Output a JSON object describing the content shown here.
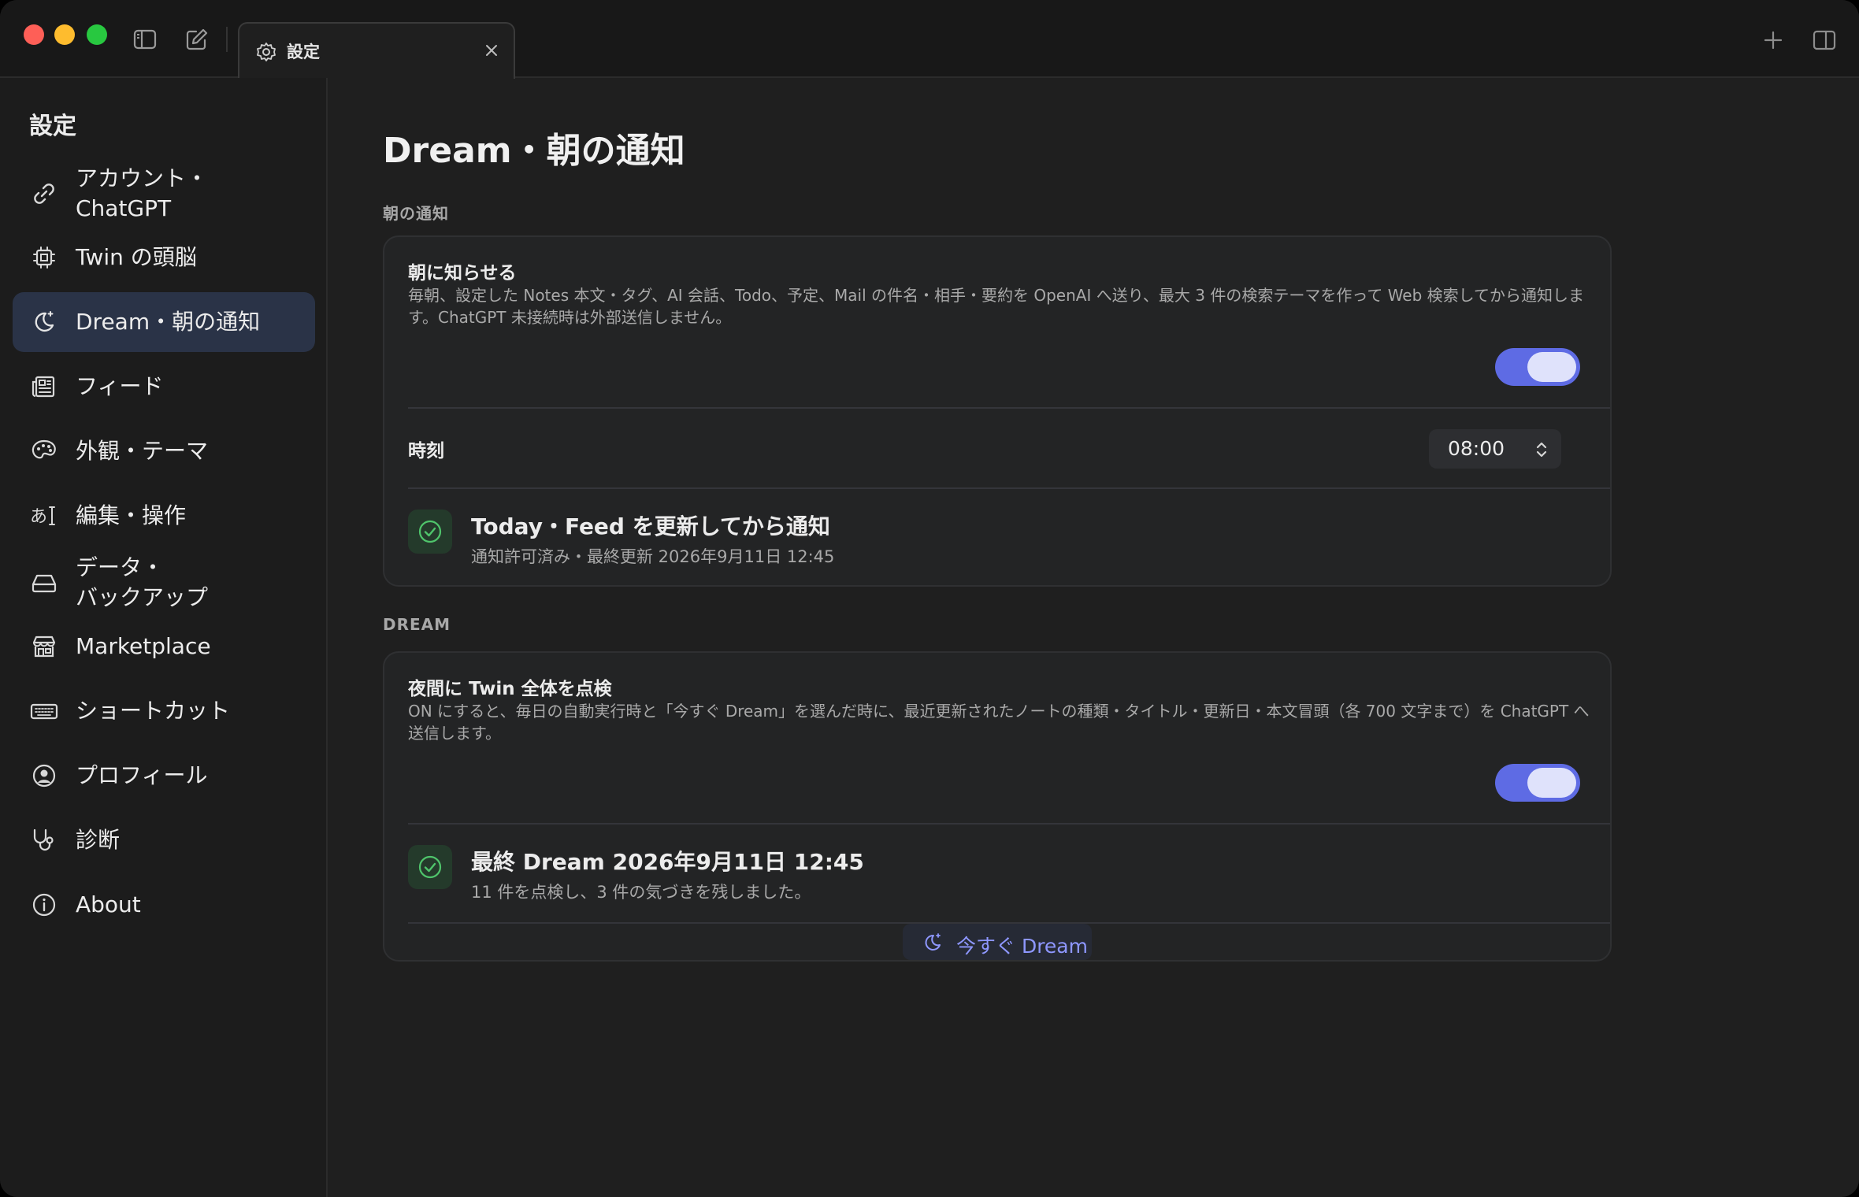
{
  "tab": {
    "label": "設定"
  },
  "sidebar": {
    "title": "設定",
    "items": [
      {
        "label": "アカウント・\nChatGPT",
        "icon": "link-icon"
      },
      {
        "label": "Twin の頭脳",
        "icon": "chip-icon"
      },
      {
        "label": "Dream・朝の通知",
        "icon": "moon-icon",
        "active": true
      },
      {
        "label": "フィード",
        "icon": "newspaper-icon"
      },
      {
        "label": "外観・テーマ",
        "icon": "palette-icon"
      },
      {
        "label": "編集・操作",
        "icon": "text-cursor-icon"
      },
      {
        "label": "データ・\nバックアップ",
        "icon": "drive-icon"
      },
      {
        "label": "Marketplace",
        "icon": "store-icon"
      },
      {
        "label": "ショートカット",
        "icon": "keyboard-icon"
      },
      {
        "label": "プロフィール",
        "icon": "user-circle-icon"
      },
      {
        "label": "診断",
        "icon": "stethoscope-icon"
      },
      {
        "label": "About",
        "icon": "info-icon"
      }
    ]
  },
  "main": {
    "title": "Dream・朝の通知",
    "morning": {
      "section_label": "朝の通知",
      "notify_title": "朝に知らせる",
      "notify_desc": "毎朝、設定した Notes 本文・タグ、AI 会話、Todo、予定、Mail の件名・相手・要約を OpenAI へ送り、最大 3 件の検索テーマを作って Web 検索してから通知します。ChatGPT 未接続時は外部送信しません。",
      "notify_enabled": true,
      "time_label": "時刻",
      "time_value": "08:00",
      "status_title": "Today・Feed を更新してから通知",
      "status_sub": "通知許可済み・最終更新 2026年9月11日 12:45"
    },
    "dream": {
      "section_label": "DREAM",
      "check_title": "夜間に Twin 全体を点検",
      "check_desc": "ON にすると、毎日の自動実行時と「今すぐ Dream」を選んだ時に、最近更新されたノートの種類・タイトル・更新日・本文冒頭（各 700 文字まで）を ChatGPT へ送信します。",
      "check_enabled": true,
      "status_title": "最終 Dream 2026年9月11日 12:45",
      "status_sub": "11 件を点検し、3 件の気づきを残しました。",
      "button_label": "今すぐ Dream"
    }
  },
  "colors": {
    "accent": "#5e6be4",
    "success": "#4fc46b",
    "link": "#8e97ff"
  }
}
